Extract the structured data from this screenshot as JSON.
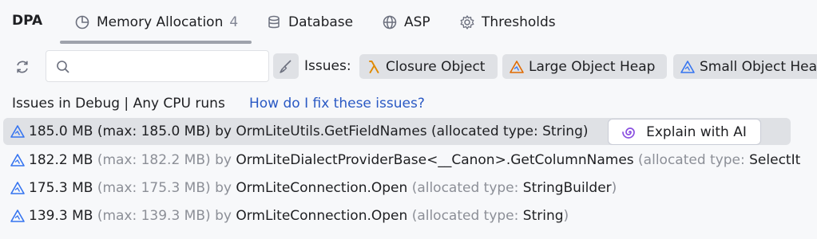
{
  "tool_title": "DPA",
  "tabs": [
    {
      "label": "Memory Allocation",
      "count": "4",
      "icon": "pie-chart-icon"
    },
    {
      "label": "Database",
      "icon": "database-icon"
    },
    {
      "label": "ASP",
      "icon": "globe-icon"
    },
    {
      "label": "Thresholds",
      "icon": "gear-icon"
    }
  ],
  "toolbar": {
    "search_value": "",
    "issues_label": "Issues:",
    "chips": [
      {
        "label": "Closure Object",
        "icon": "lambda-icon"
      },
      {
        "label": "Large Object Heap",
        "icon": "warning-triangle-icon"
      },
      {
        "label": "Small Object Heap",
        "icon": "triangle-icon"
      }
    ]
  },
  "info": {
    "scope": "Issues in Debug | Any CPU runs",
    "link": "How do I fix these issues?"
  },
  "rows": [
    {
      "size": "185.0 MB",
      "max": "(max: 185.0 MB)",
      "by": "by",
      "method": "OrmLiteUtils.GetFieldNames",
      "type_label": "(allocated type:",
      "type": "String",
      "close": ")"
    },
    {
      "size": "182.2 MB",
      "max": "(max: 182.2 MB)",
      "by": "by",
      "method": "OrmLiteDialectProviderBase<__Canon>.GetColumnNames",
      "type_label": "(allocated type:",
      "type": "SelectIt",
      "close": ""
    },
    {
      "size": "175.3 MB",
      "max": "(max: 175.3 MB)",
      "by": "by",
      "method": "OrmLiteConnection.Open",
      "type_label": "(allocated type:",
      "type": "StringBuilder",
      "close": ")"
    },
    {
      "size": "139.3 MB",
      "max": "(max: 139.3 MB)",
      "by": "by",
      "method": "OrmLiteConnection.Open",
      "type_label": "(allocated type:",
      "type": "String",
      "close": ")"
    }
  ],
  "explain_button": "Explain with AI",
  "colors": {
    "link": "#2a59c4",
    "muted": "#8c8f97",
    "lambda": "#e08a00",
    "warning": "#e06a00",
    "triangle_blue": "#3574f0",
    "ai": "#8a4fe0"
  }
}
